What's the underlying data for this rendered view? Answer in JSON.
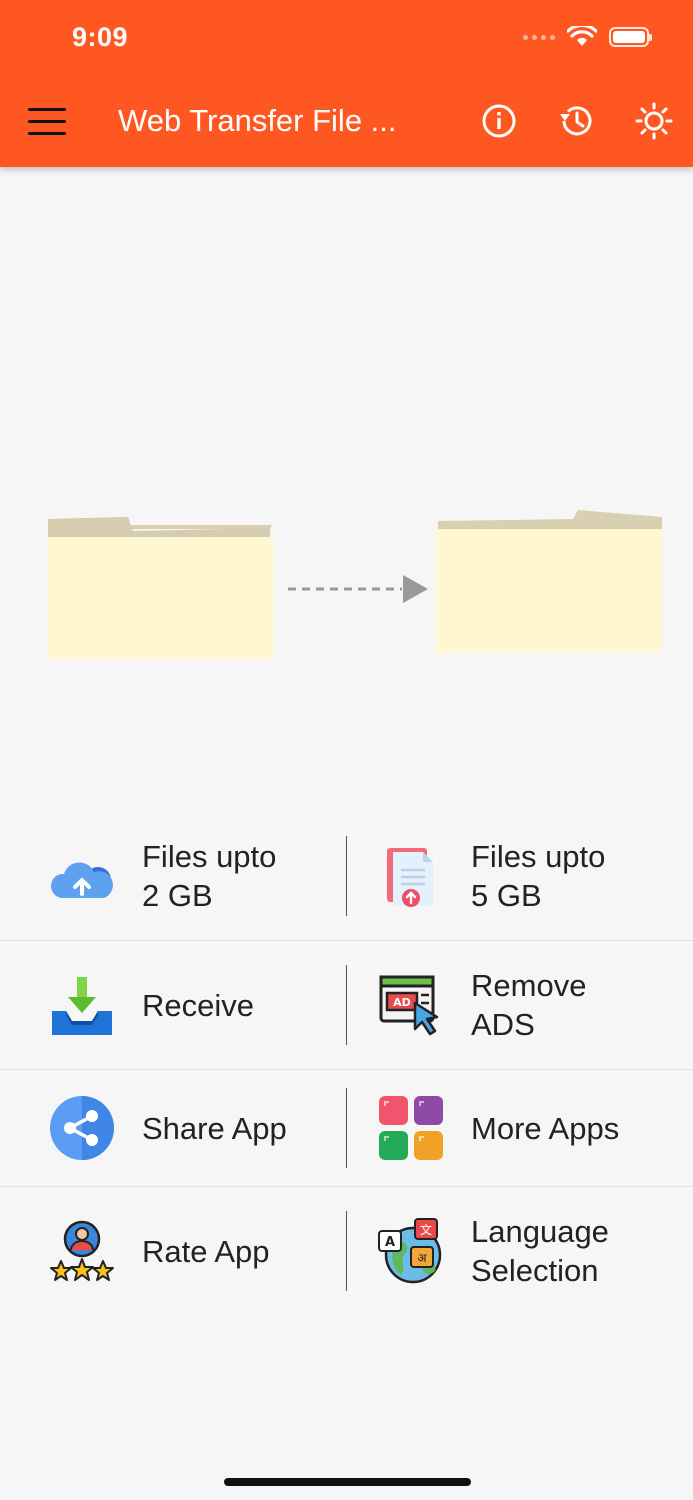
{
  "status_bar": {
    "time": "9:09"
  },
  "header": {
    "title": "Web Transfer File ...",
    "accent_color": "#ff5722",
    "icons": [
      "menu-icon",
      "info-icon",
      "history-icon",
      "brightness-icon"
    ]
  },
  "features": [
    {
      "left": {
        "line1": "Files upto",
        "line2": "2 GB",
        "icon": "cloud-upload-icon"
      },
      "right": {
        "line1": "Files upto",
        "line2": "5 GB",
        "icon": "file-upload-icon"
      }
    },
    {
      "left": {
        "line1": "Receive",
        "line2": "",
        "icon": "download-tray-icon"
      },
      "right": {
        "line1": "Remove",
        "line2": "ADS",
        "icon": "ad-block-icon"
      }
    },
    {
      "left": {
        "line1": "Share App",
        "line2": "",
        "icon": "share-icon"
      },
      "right": {
        "line1": "More Apps",
        "line2": "",
        "icon": "apps-grid-icon"
      }
    },
    {
      "left": {
        "line1": "Rate App",
        "line2": "",
        "icon": "rate-stars-icon"
      },
      "right": {
        "line1": "Language",
        "line2": "Selection",
        "icon": "language-globe-icon"
      }
    }
  ]
}
